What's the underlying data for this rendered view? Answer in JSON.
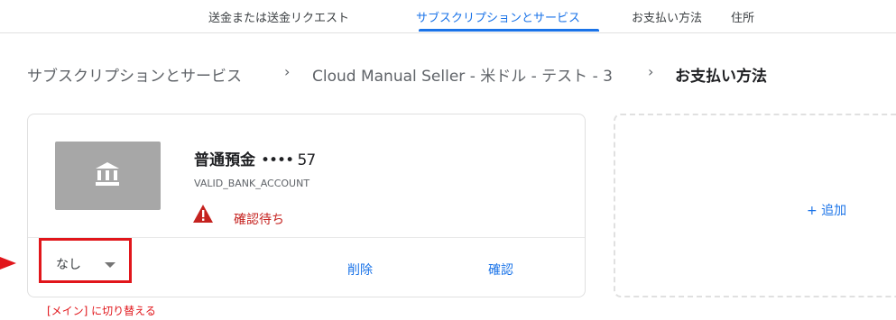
{
  "tabs": [
    {
      "label": "送金または送金リクエスト",
      "active": false
    },
    {
      "label": "サブスクリプションとサービス",
      "active": true
    },
    {
      "label": "お支払い方法",
      "active": false
    },
    {
      "label": "住所",
      "active": false
    }
  ],
  "breadcrumb": {
    "items": [
      "サブスクリプションとサービス",
      "Cloud Manual Seller - 米ドル - テスト - 3",
      "お支払い方法"
    ],
    "separator": "›"
  },
  "payment_method": {
    "name": "普通預金",
    "masked": "•••• 57",
    "type": "VALID_BANK_ACCOUNT",
    "status": "確認待ち",
    "icon": "bank-icon",
    "role_select": {
      "value": "なし"
    },
    "delete_label": "削除",
    "verify_label": "確認"
  },
  "annotation": {
    "text": "[メイン] に切り替える"
  },
  "add_card": {
    "label": "+ 追加"
  },
  "colors": {
    "accent": "#1a73e8",
    "warning": "#c5221f",
    "annotation": "#e1161b"
  }
}
